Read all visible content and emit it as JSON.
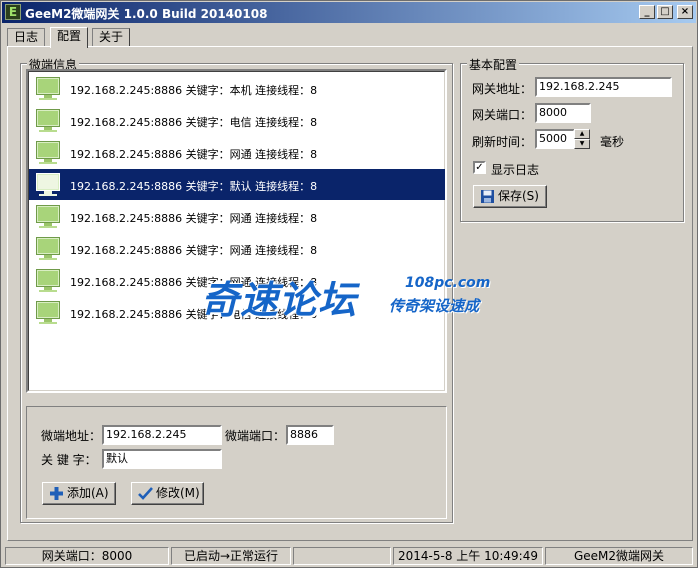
{
  "window": {
    "title": "GeeM2微端网关 1.0.0 Build 20140108",
    "icon_letter": "E",
    "minimize_glyph": "_",
    "maximize_glyph": "□",
    "close_glyph": "×"
  },
  "tabs": [
    {
      "label": "日志",
      "active": false
    },
    {
      "label": "配置",
      "active": true
    },
    {
      "label": "关于",
      "active": false
    }
  ],
  "client_info": {
    "title": "微端信息",
    "rows": [
      {
        "text": "192.168.2.245:8886 关键字：本机 连接线程：8",
        "selected": false
      },
      {
        "text": "192.168.2.245:8886 关键字：电信 连接线程：8",
        "selected": false
      },
      {
        "text": "192.168.2.245:8886 关键字：网通 连接线程：8",
        "selected": false
      },
      {
        "text": "192.168.2.245:8886 关键字：默认 连接线程：8",
        "selected": true
      },
      {
        "text": "192.168.2.245:8886 关键字：网通 连接线程：8",
        "selected": false
      },
      {
        "text": "192.168.2.245:8886 关键字：网通 连接线程：8",
        "selected": false
      },
      {
        "text": "192.168.2.245:8886 关键字：网通 连接线程：8",
        "selected": false
      },
      {
        "text": "192.168.2.245:8886 关键字：电信 连接线程：8",
        "selected": false
      }
    ]
  },
  "client_form": {
    "address_label": "微端地址：",
    "address_value": "192.168.2.245",
    "port_label": "微端端口：",
    "port_value": "8886",
    "keyword_label": "关 键 字：",
    "keyword_value": "默认",
    "add_button": "添加(A)",
    "modify_button": "修改(M)"
  },
  "basic_config": {
    "title": "基本配置",
    "gateway_address_label": "网关地址：",
    "gateway_address_value": "192.168.2.245",
    "gateway_port_label": "网关端口：",
    "gateway_port_value": "8000",
    "refresh_label": "刷新时间：",
    "refresh_value": "5000",
    "refresh_unit": "毫秒",
    "show_log_label": "显示日志",
    "show_log_checked": true,
    "save_button": "保存(S)"
  },
  "watermark": {
    "brand": "奇速论坛",
    "site": "108pc.com",
    "slogan": "传奇架设速成"
  },
  "status_bar": {
    "gateway_port": "网关端口：8000",
    "state": "已启动→正常运行",
    "empty": "",
    "datetime": "2014-5-8  上午  10:49:49",
    "app_name": "GeeM2微端网关"
  }
}
